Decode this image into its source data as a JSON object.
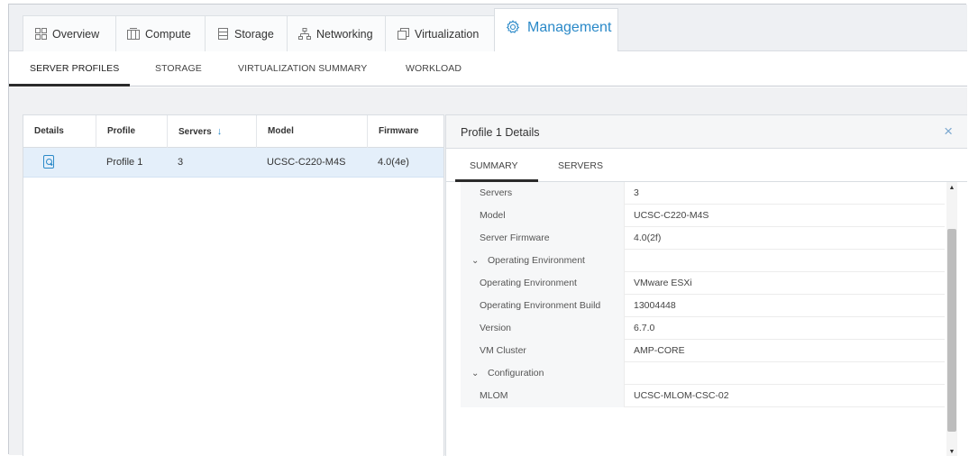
{
  "top_tabs": [
    {
      "label": "Overview",
      "icon": "grid-icon"
    },
    {
      "label": "Compute",
      "icon": "server-rack-icon"
    },
    {
      "label": "Storage",
      "icon": "storage-icon"
    },
    {
      "label": "Networking",
      "icon": "network-icon"
    },
    {
      "label": "Virtualization",
      "icon": "virtualization-icon"
    },
    {
      "label": "Management",
      "icon": "gear-icon",
      "active": true
    }
  ],
  "sub_tabs": [
    {
      "label": "SERVER PROFILES",
      "active": true
    },
    {
      "label": "STORAGE"
    },
    {
      "label": "VIRTUALIZATION SUMMARY"
    },
    {
      "label": "WORKLOAD"
    }
  ],
  "table": {
    "columns": [
      "Details",
      "Profile",
      "Servers",
      "Model",
      "Firmware"
    ],
    "rows": [
      {
        "profile": "Profile 1",
        "servers": "3",
        "model": "UCSC-C220-M4S",
        "firmware": "4.0(4e)"
      }
    ]
  },
  "details": {
    "title": "Profile 1 Details",
    "close_symbol": "×",
    "tabs": [
      "SUMMARY",
      "SERVERS"
    ],
    "rows": [
      {
        "key": "Servers",
        "value": "3"
      },
      {
        "key": "Model",
        "value": "UCSC-C220-M4S"
      },
      {
        "key": "Server Firmware",
        "value": "4.0(2f)"
      },
      {
        "key": "Operating Environment",
        "value": "",
        "group": true
      },
      {
        "key": "Operating Environment",
        "value": "VMware ESXi"
      },
      {
        "key": "Operating Environment Build",
        "value": "13004448"
      },
      {
        "key": "Version",
        "value": "6.7.0"
      },
      {
        "key": "VM Cluster",
        "value": "AMP-CORE"
      },
      {
        "key": "Configuration",
        "value": "",
        "group": true
      },
      {
        "key": "MLOM",
        "value": "UCSC-MLOM-CSC-02"
      }
    ]
  },
  "colors": {
    "accent": "#2a89c8",
    "selected_row": "#e4effa"
  }
}
